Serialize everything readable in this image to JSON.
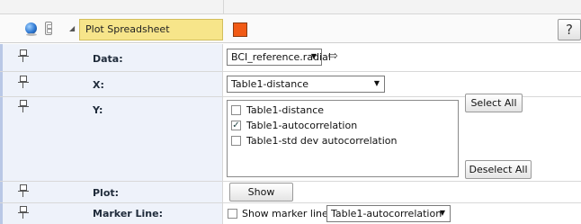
{
  "header": {
    "title": "Plot Spreadsheet",
    "swatch_color": "#f15a15",
    "help_label": "?",
    "icons": [
      "globe-icon",
      "notebook-icon",
      "collapse-triangle-icon"
    ]
  },
  "rows": {
    "data": {
      "label": "Data:",
      "value": "BCI_reference.radial",
      "arrow_icon": "⇨"
    },
    "x": {
      "label": "X:",
      "value": "Table1-distance"
    },
    "y": {
      "label": "Y:",
      "items": [
        {
          "label": "Table1-distance",
          "checked": false
        },
        {
          "label": "Table1-autocorrelation",
          "checked": true
        },
        {
          "label": "Table1-std dev autocorrelation",
          "checked": false
        }
      ],
      "select_all_label": "Select All",
      "deselect_all_label": "Deselect All"
    },
    "plot": {
      "label": "Plot:",
      "button_label": "Show"
    },
    "marker": {
      "label": "Marker Line:",
      "checkbox_label": "Show marker line",
      "checked": false,
      "value": "Table1-autocorrelation"
    }
  },
  "symbols": {
    "dropdown_arrow": "▼",
    "collapse_arrow": "◢",
    "check_mark": "✓"
  }
}
